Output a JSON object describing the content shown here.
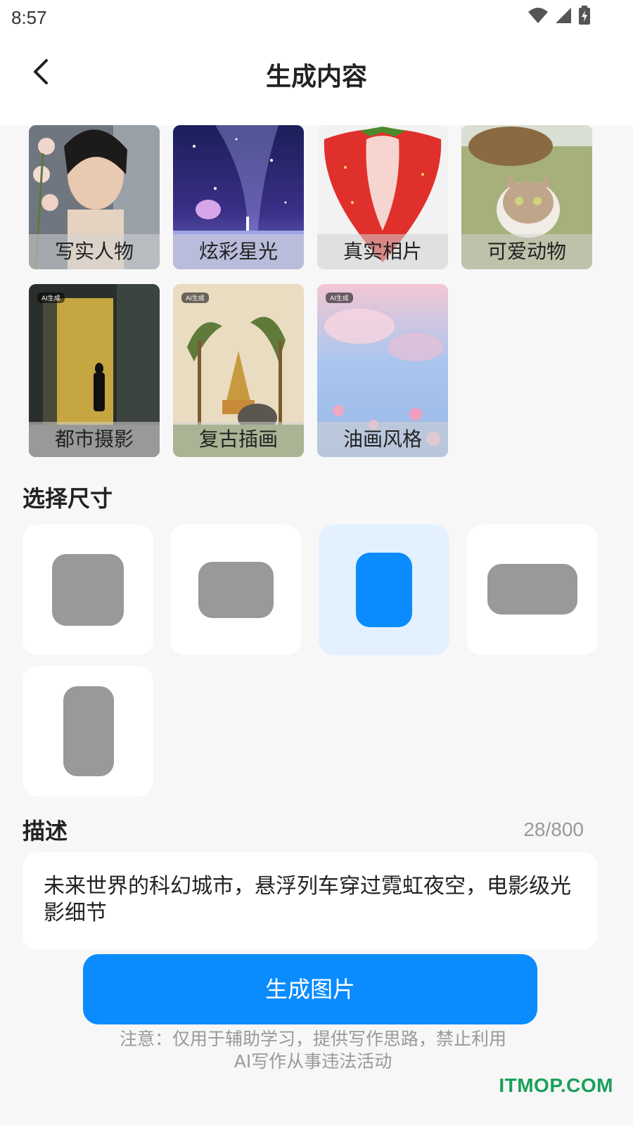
{
  "status_bar": {
    "time": "8:57"
  },
  "header": {
    "title": "生成内容"
  },
  "styles": {
    "ai_badge": "AI生成",
    "items": [
      {
        "label": "写实人物",
        "selected": true
      },
      {
        "label": "炫彩星光",
        "selected": false
      },
      {
        "label": "真实相片",
        "selected": false
      },
      {
        "label": "可爱动物",
        "selected": false
      },
      {
        "label": "都市摄影",
        "selected": false
      },
      {
        "label": "复古插画",
        "selected": false
      },
      {
        "label": "油画风格",
        "selected": false
      }
    ]
  },
  "size_section": {
    "title": "选择尺寸",
    "options": [
      {
        "name": "square",
        "selected": false
      },
      {
        "name": "landscape",
        "selected": false
      },
      {
        "name": "portrait",
        "selected": true
      },
      {
        "name": "wide",
        "selected": false
      },
      {
        "name": "tall",
        "selected": false
      }
    ]
  },
  "description": {
    "title": "描述",
    "count": "28/800",
    "text": "未来世界的科幻城市，悬浮列车穿过霓虹夜空，电影级光影细节"
  },
  "generate_button": {
    "label": "生成图片"
  },
  "notice": {
    "line1": "注意：仅用于辅助学习，提供写作思路，禁止利用",
    "line2": "AI写作从事违法活动"
  },
  "watermark": "ITMOP.COM",
  "colors": {
    "accent": "#0a8cff",
    "selected_tile": "#e3f1fe",
    "shape_gray": "#999999",
    "watermark": "#1aa05a"
  }
}
